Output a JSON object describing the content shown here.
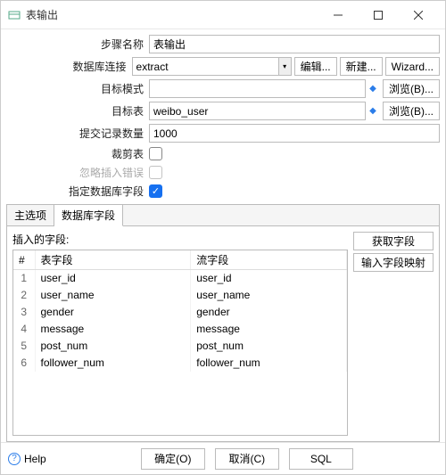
{
  "window": {
    "title": "表输出"
  },
  "form": {
    "step_name_label": "步骤名称",
    "step_name_value": "表输出",
    "db_conn_label": "数据库连接",
    "db_conn_value": "extract",
    "edit_label": "编辑...",
    "new_label": "新建...",
    "wizard_label": "Wizard...",
    "target_schema_label": "目标模式",
    "target_schema_value": "",
    "browse_label": "浏览(B)...",
    "target_table_label": "目标表",
    "target_table_value": "weibo_user",
    "commit_size_label": "提交记录数量",
    "commit_size_value": "1000",
    "truncate_label": "裁剪表",
    "ignore_err_label": "忽略插入错误",
    "specify_fields_label": "指定数据库字段"
  },
  "tabs": {
    "main": "主选项",
    "db_fields": "数据库字段"
  },
  "fields": {
    "section_label": "插入的字段:",
    "col_num": "#",
    "col_table_field": "表字段",
    "col_stream_field": "流字段",
    "rows": [
      {
        "n": "1",
        "table_field": "user_id",
        "stream_field": "user_id"
      },
      {
        "n": "2",
        "table_field": "user_name",
        "stream_field": "user_name"
      },
      {
        "n": "3",
        "table_field": "gender",
        "stream_field": "gender"
      },
      {
        "n": "4",
        "table_field": "message",
        "stream_field": "message"
      },
      {
        "n": "5",
        "table_field": "post_num",
        "stream_field": "post_num"
      },
      {
        "n": "6",
        "table_field": "follower_num",
        "stream_field": "follower_num"
      }
    ],
    "get_fields_label": "获取字段",
    "enter_mapping_label": "输入字段映射"
  },
  "footer": {
    "help": "Help",
    "ok": "确定(O)",
    "cancel": "取消(C)",
    "sql": "SQL"
  }
}
